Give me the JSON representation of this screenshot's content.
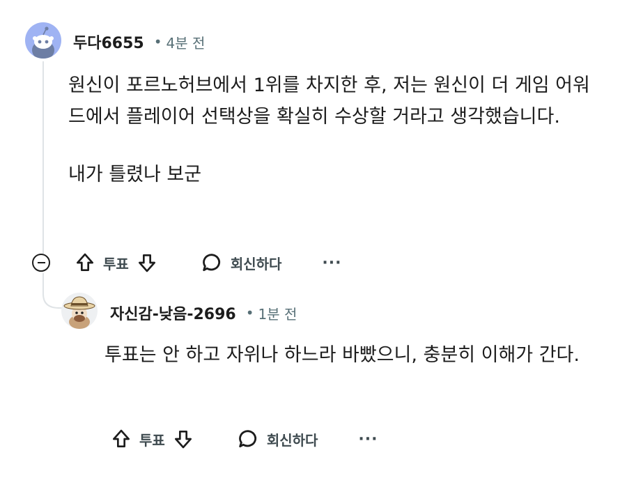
{
  "comments": [
    {
      "username": "두다6655",
      "time": "4분 전",
      "avatar_icon": "reddit-snoo-avatar",
      "paragraphs": [
        "원신이 포르노허브에서 1위를 차지한 후, 저는 원신이 더 게임 어워드에서 플레이어 선택상을 확실히 수상할 거라고 생각했습니다.",
        "내가 틀렸나 보군"
      ],
      "actions": {
        "vote_label": "투표",
        "reply_label": "회신하다",
        "more_label": "···"
      }
    },
    {
      "username": "자신감-낮음-2696",
      "time": "1분 전",
      "avatar_icon": "hat-wearing-avatar",
      "paragraphs": [
        "투표는 안 하고 자위나 하느라 바빴으니, 충분히 이해가 간다."
      ],
      "actions": {
        "vote_label": "투표",
        "reply_label": "회신하다",
        "more_label": "···"
      }
    }
  ],
  "separator": "•",
  "colors": {
    "avatar1_bg": "#9fb3f3",
    "meta_text": "#576f76",
    "thread_line": "#dfe3e6"
  }
}
